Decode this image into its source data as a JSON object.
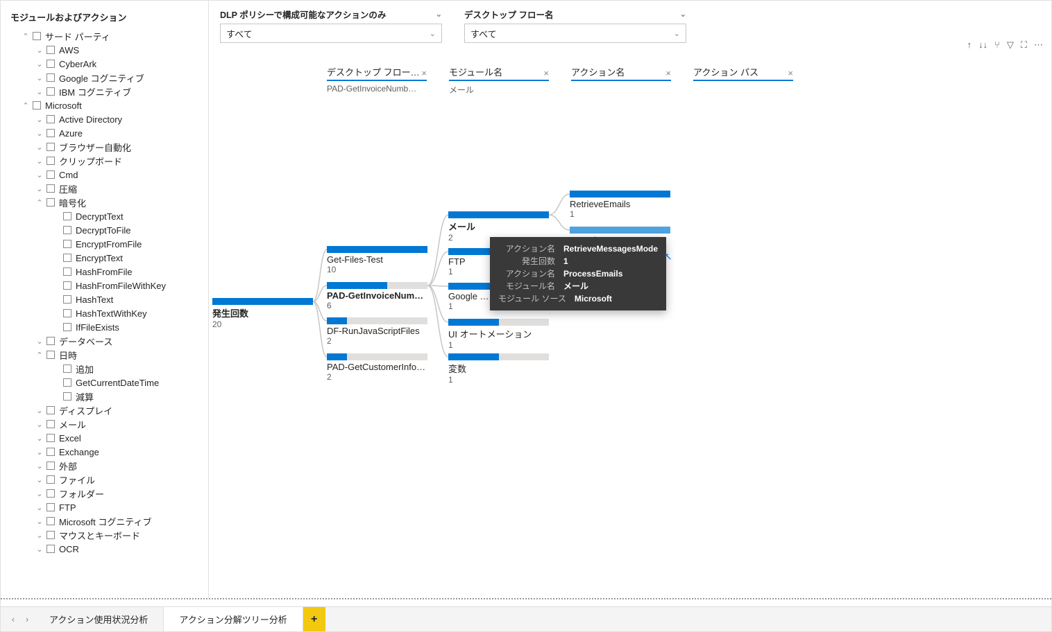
{
  "sidebar": {
    "title": "モジュールおよびアクション",
    "tree": [
      {
        "lvl": 1,
        "exp": true,
        "chk": true,
        "label": "サード パーティ"
      },
      {
        "lvl": 2,
        "exp": false,
        "chk": true,
        "label": "AWS"
      },
      {
        "lvl": 2,
        "exp": false,
        "chk": true,
        "label": "CyberArk"
      },
      {
        "lvl": 2,
        "exp": false,
        "chk": true,
        "label": "Google コグニティブ"
      },
      {
        "lvl": 2,
        "exp": false,
        "chk": true,
        "label": "IBM コグニティブ"
      },
      {
        "lvl": 1,
        "exp": true,
        "chk": true,
        "label": "Microsoft"
      },
      {
        "lvl": 2,
        "exp": false,
        "chk": true,
        "label": "Active Directory"
      },
      {
        "lvl": 2,
        "exp": false,
        "chk": true,
        "label": "Azure"
      },
      {
        "lvl": 2,
        "exp": false,
        "chk": true,
        "label": "ブラウザー自動化"
      },
      {
        "lvl": 2,
        "exp": false,
        "chk": true,
        "label": "クリップボード"
      },
      {
        "lvl": 2,
        "exp": false,
        "chk": true,
        "label": "Cmd"
      },
      {
        "lvl": 2,
        "exp": false,
        "chk": true,
        "label": "圧縮"
      },
      {
        "lvl": 2,
        "exp": true,
        "chk": true,
        "label": "暗号化"
      },
      {
        "lvl": 3,
        "chk": true,
        "label": "DecryptText"
      },
      {
        "lvl": 3,
        "chk": true,
        "label": "DecryptToFile"
      },
      {
        "lvl": 3,
        "chk": true,
        "label": "EncryptFromFile"
      },
      {
        "lvl": 3,
        "chk": true,
        "label": "EncryptText"
      },
      {
        "lvl": 3,
        "chk": true,
        "label": "HashFromFile"
      },
      {
        "lvl": 3,
        "chk": true,
        "label": "HashFromFileWithKey"
      },
      {
        "lvl": 3,
        "chk": true,
        "label": "HashText"
      },
      {
        "lvl": 3,
        "chk": true,
        "label": "HashTextWithKey"
      },
      {
        "lvl": 3,
        "chk": true,
        "label": "IfFileExists"
      },
      {
        "lvl": 2,
        "exp": false,
        "chk": true,
        "label": "データベース"
      },
      {
        "lvl": 2,
        "exp": true,
        "chk": true,
        "label": "日時"
      },
      {
        "lvl": 3,
        "chk": true,
        "label": "追加"
      },
      {
        "lvl": 3,
        "chk": true,
        "label": "GetCurrentDateTime"
      },
      {
        "lvl": 3,
        "chk": true,
        "label": "減算"
      },
      {
        "lvl": 2,
        "exp": false,
        "chk": true,
        "label": "ディスプレイ"
      },
      {
        "lvl": 2,
        "exp": false,
        "chk": true,
        "label": "メール"
      },
      {
        "lvl": 2,
        "exp": false,
        "chk": true,
        "label": "Excel"
      },
      {
        "lvl": 2,
        "exp": false,
        "chk": true,
        "label": "Exchange"
      },
      {
        "lvl": 2,
        "exp": false,
        "chk": true,
        "label": "外部"
      },
      {
        "lvl": 2,
        "exp": false,
        "chk": true,
        "label": "ファイル"
      },
      {
        "lvl": 2,
        "exp": false,
        "chk": true,
        "label": "フォルダー"
      },
      {
        "lvl": 2,
        "exp": false,
        "chk": true,
        "label": "FTP"
      },
      {
        "lvl": 2,
        "exp": false,
        "chk": true,
        "label": "Microsoft コグニティブ"
      },
      {
        "lvl": 2,
        "exp": false,
        "chk": true,
        "label": "マウスとキーボード"
      },
      {
        "lvl": 2,
        "exp": false,
        "chk": true,
        "label": "OCR"
      }
    ]
  },
  "filters": {
    "dlp": {
      "label": "DLP ポリシーで構成可能なアクションのみ",
      "value": "すべて"
    },
    "flow": {
      "label": "デスクトップ フロー名",
      "value": "すべて"
    }
  },
  "columns": {
    "c1": {
      "title": "デスクトップ フロー…",
      "sub": "PAD-GetInvoiceNumb…"
    },
    "c2": {
      "title": "モジュール名",
      "sub": "メール"
    },
    "c3": {
      "title": "アクション名",
      "sub": ""
    },
    "c4": {
      "title": "アクション パス",
      "sub": ""
    }
  },
  "root": {
    "label": "発生回数",
    "value": "20"
  },
  "lvl1": [
    {
      "label": "Get-Files-Test",
      "value": "10",
      "fill": 100,
      "bold": false
    },
    {
      "label": "PAD-GetInvoiceNum…",
      "value": "6",
      "fill": 60,
      "bold": true
    },
    {
      "label": "DF-RunJavaScriptFiles",
      "value": "2",
      "fill": 20,
      "bold": false
    },
    {
      "label": "PAD-GetCustomerInfo…",
      "value": "2",
      "fill": 20,
      "bold": false
    }
  ],
  "lvl2": [
    {
      "label": "メール",
      "value": "2",
      "fill": 100,
      "bold": true
    },
    {
      "label": "FTP",
      "value": "1",
      "fill": 50,
      "bold": false
    },
    {
      "label": "Google …",
      "value": "1",
      "fill": 50,
      "bold": false
    },
    {
      "label": "UI オートメーション",
      "value": "1",
      "fill": 50,
      "bold": false
    },
    {
      "label": "変数",
      "value": "1",
      "fill": 50,
      "bold": false
    }
  ],
  "lvl3": [
    {
      "label": "RetrieveEmails",
      "value": "1",
      "fill": 100,
      "sel": false
    },
    {
      "label": "…Mode",
      "value": "",
      "fill": 100,
      "sel": true
    }
  ],
  "tooltip": {
    "rows": [
      {
        "k": "アクション名",
        "v": "RetrieveMessagesMode"
      },
      {
        "k": "発生回数",
        "v": "1"
      },
      {
        "k": "アクション名",
        "v": "ProcessEmails"
      },
      {
        "k": "モジュール名",
        "v": "メール"
      },
      {
        "k": "モジュール ソース",
        "v": "Microsoft"
      }
    ]
  },
  "tabs": {
    "t1": "アクション使用状況分析",
    "t2": "アクション分解ツリー分析",
    "add": "+"
  },
  "chart_data": {
    "type": "tree",
    "root": {
      "name": "発生回数",
      "value": 20
    },
    "children": [
      {
        "name": "Get-Files-Test",
        "value": 10
      },
      {
        "name": "PAD-GetInvoiceNum…",
        "value": 6,
        "selected": true,
        "children": [
          {
            "name": "メール",
            "value": 2,
            "selected": true,
            "children": [
              {
                "name": "RetrieveEmails",
                "value": 1
              },
              {
                "name": "RetrieveMessagesMode",
                "value": 1
              }
            ]
          },
          {
            "name": "FTP",
            "value": 1
          },
          {
            "name": "Google …",
            "value": 1
          },
          {
            "name": "UI オートメーション",
            "value": 1
          },
          {
            "name": "変数",
            "value": 1
          }
        ]
      },
      {
        "name": "DF-RunJavaScriptFiles",
        "value": 2
      },
      {
        "name": "PAD-GetCustomerInfo…",
        "value": 2
      }
    ]
  }
}
